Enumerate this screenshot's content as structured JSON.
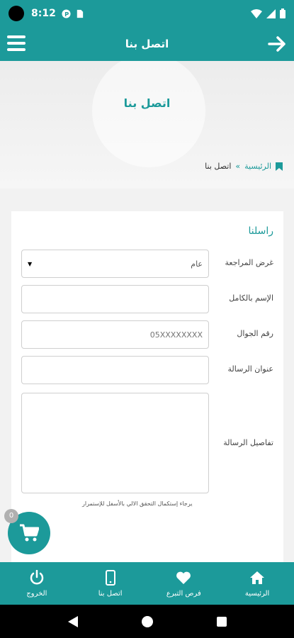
{
  "status_bar": {
    "time": "8:12"
  },
  "app_bar": {
    "title": "اتصل بنا"
  },
  "hero": {
    "title": "اتصل بنا"
  },
  "breadcrumb": {
    "home": "الرئيسية",
    "separator": "»",
    "current": "اتصل بنا"
  },
  "form": {
    "title": "راسلنا",
    "purpose_label": "غرض المراجعة",
    "purpose_value": "عام",
    "name_label": "الإسم بالكامل",
    "name_value": "",
    "phone_label": "رقم الجوال",
    "phone_placeholder": "05XXXXXXXX",
    "subject_label": "عنوان الرسالة",
    "subject_value": "",
    "details_label": "تفاصيل الرسالة",
    "details_value": "",
    "hint": "يرجاء إستكمال التحقق الالي بالأسفل للإستمرار"
  },
  "cart": {
    "count": "0"
  },
  "bottom_nav": {
    "items": [
      {
        "label": "الرئيسية",
        "icon": "home-icon"
      },
      {
        "label": "فرص التبرع",
        "icon": "heart-icon"
      },
      {
        "label": "اتصل بنا",
        "icon": "phone-icon"
      },
      {
        "label": "الخروج",
        "icon": "power-icon"
      }
    ]
  },
  "colors": {
    "primary": "#1c9a9a"
  }
}
